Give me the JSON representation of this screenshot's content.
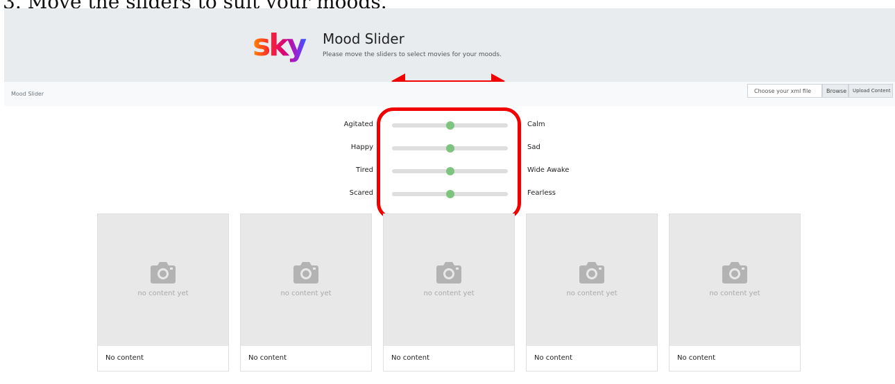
{
  "caption": "3. Move the sliders to suit your moods.",
  "header": {
    "logo_text": "sky",
    "title": "Mood Slider",
    "subtitle": "Please move the sliders to select movies for your moods."
  },
  "navbar": {
    "brand": "Mood Slider",
    "file_input_placeholder": "Choose your xml file",
    "browse_label": "Browse",
    "upload_label": "Upload Content"
  },
  "sliders": [
    {
      "left": "Agitated",
      "right": "Calm",
      "value": 0.5
    },
    {
      "left": "Happy",
      "right": "Sad",
      "value": 0.5
    },
    {
      "left": "Tired",
      "right": "Wide Awake",
      "value": 0.5
    },
    {
      "left": "Scared",
      "right": "Fearless",
      "value": 0.5
    }
  ],
  "cards": [
    {
      "placeholder": "no content yet",
      "footer": "No content"
    },
    {
      "placeholder": "no content yet",
      "footer": "No content"
    },
    {
      "placeholder": "no content yet",
      "footer": "No content"
    },
    {
      "placeholder": "no content yet",
      "footer": "No content"
    },
    {
      "placeholder": "no content yet",
      "footer": "No content"
    }
  ],
  "icons": {
    "camera": "camera-icon",
    "arrow": "double-headed-arrow-icon"
  },
  "colors": {
    "annotation_red": "#f20000",
    "slider_thumb": "#7dc47f",
    "slider_track": "#dedede",
    "header_bg": "#e9ecef"
  }
}
